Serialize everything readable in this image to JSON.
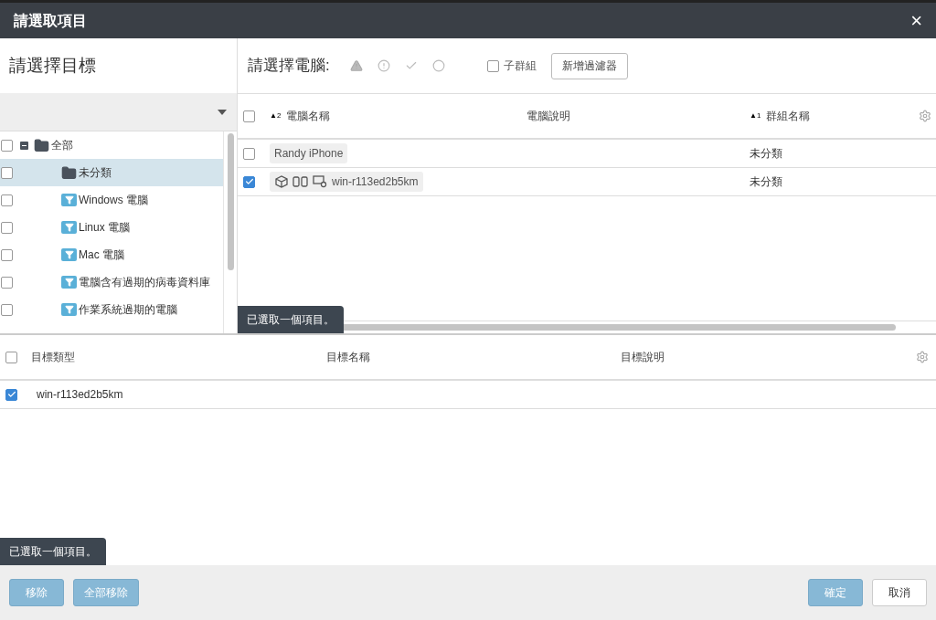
{
  "window": {
    "title": "請選取項目",
    "close": "×"
  },
  "target_panel": {
    "title": "請選擇目標",
    "tree": [
      {
        "label": "全部",
        "kind": "folder",
        "checked": false,
        "selected": false,
        "expanded": true,
        "children": [
          {
            "label": "未分類",
            "kind": "folder",
            "checked": false,
            "selected": true
          },
          {
            "label": "Windows 電腦",
            "kind": "filter",
            "checked": false,
            "selected": false
          },
          {
            "label": "Linux 電腦",
            "kind": "filter",
            "checked": false,
            "selected": false
          },
          {
            "label": "Mac 電腦",
            "kind": "filter",
            "checked": false,
            "selected": false
          },
          {
            "label": "電腦含有過期的病毒資料庫",
            "kind": "filter",
            "checked": false,
            "selected": false
          },
          {
            "label": "作業系統過期的電腦",
            "kind": "filter",
            "checked": false,
            "selected": false
          }
        ]
      }
    ]
  },
  "computer_panel": {
    "title": "請選擇電腦:",
    "subgroup": {
      "label": "子群組",
      "checked": false
    },
    "add_filter_button": "新增過濾器",
    "select_all_checked": false,
    "columns": [
      {
        "label": "電腦名稱",
        "sort": "▲2"
      },
      {
        "label": "電腦說明"
      },
      {
        "label": "群組名稱",
        "sort": "▲1"
      }
    ],
    "rows": [
      {
        "name": "Randy iPhone",
        "checked": false,
        "icons": false,
        "group": "未分類"
      },
      {
        "name": "win-r113ed2b5km",
        "checked": true,
        "icons": true,
        "group": "未分類"
      }
    ],
    "selection_note": "已選取一個項目。"
  },
  "selected_panel": {
    "select_all_checked": false,
    "columns": [
      "目標類型",
      "目標名稱",
      "目標說明"
    ],
    "rows": [
      {
        "type": "win-r113ed2b5km",
        "checked": true
      }
    ],
    "selection_note": "已選取一個項目。"
  },
  "footer": {
    "remove": "移除",
    "remove_all": "全部移除",
    "ok": "確定",
    "cancel": "取消"
  }
}
